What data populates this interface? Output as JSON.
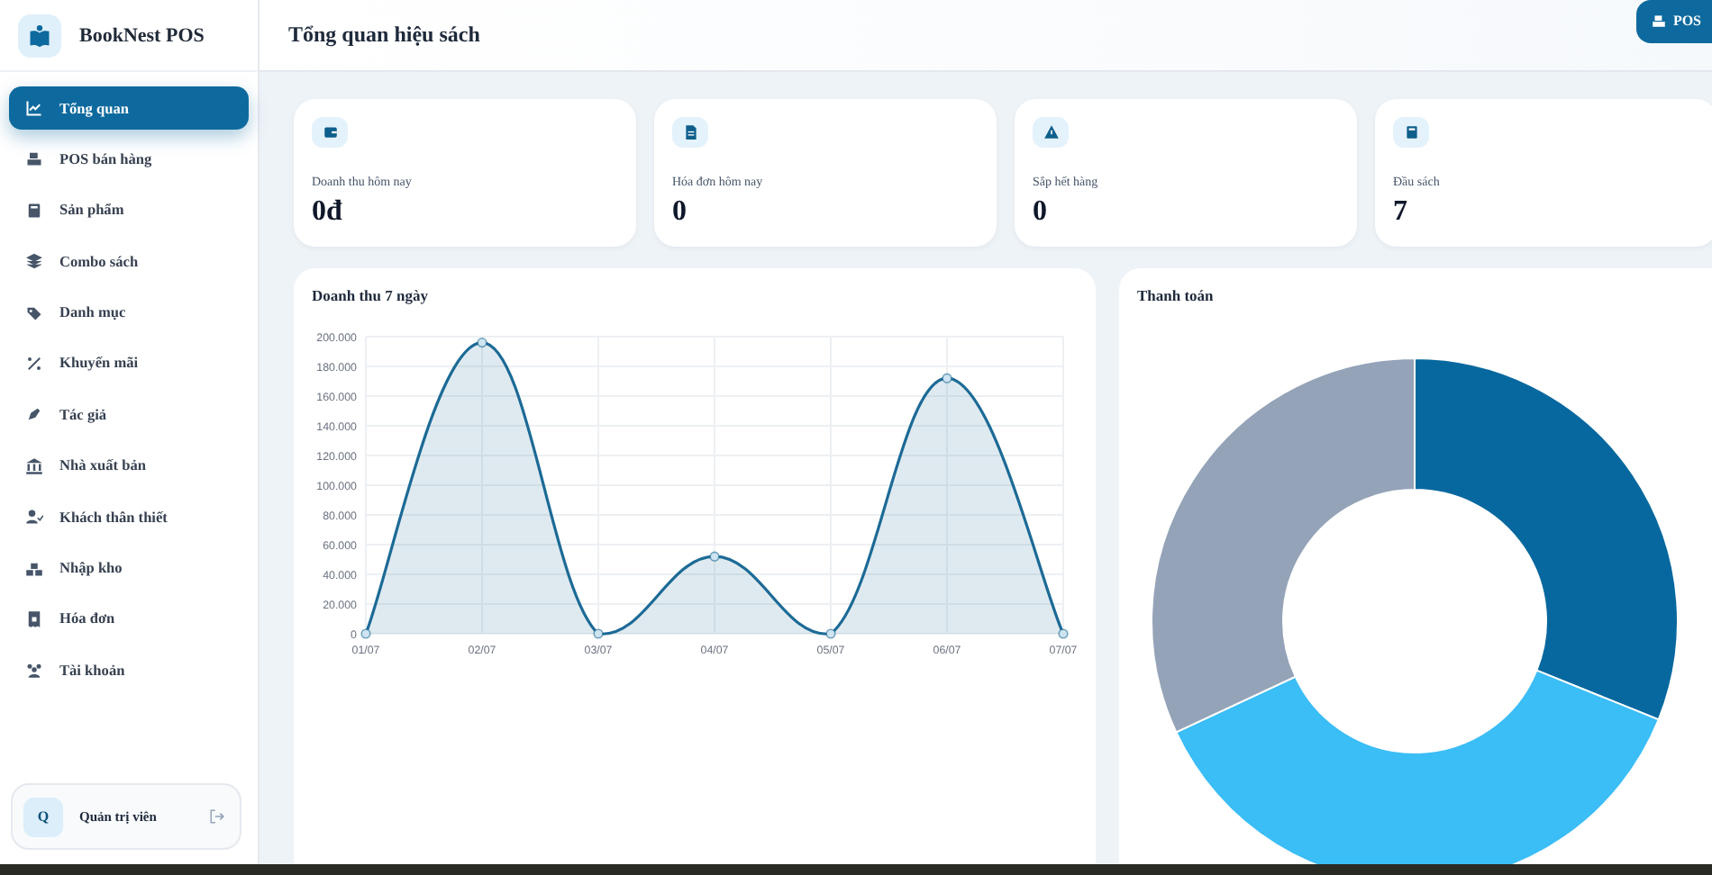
{
  "brand": {
    "name": "BookNest POS"
  },
  "sidebar": {
    "items": [
      {
        "label": "Tổng quan",
        "selected": true
      },
      {
        "label": "POS bán hàng",
        "selected": false
      },
      {
        "label": "Sản phẩm",
        "selected": false
      },
      {
        "label": "Combo sách",
        "selected": false
      },
      {
        "label": "Danh mục",
        "selected": false
      },
      {
        "label": "Khuyến mãi",
        "selected": false
      },
      {
        "label": "Tác giả",
        "selected": false
      },
      {
        "label": "Nhà xuất bản",
        "selected": false
      },
      {
        "label": "Khách thân thiết",
        "selected": false
      },
      {
        "label": "Nhập kho",
        "selected": false
      },
      {
        "label": "Hóa đơn",
        "selected": false
      },
      {
        "label": "Tài khoản",
        "selected": false
      }
    ],
    "user": {
      "avatar": "Q",
      "name": "Quản trị viên"
    }
  },
  "header": {
    "title": "Tổng quan hiệu sách",
    "button": "POS"
  },
  "stats": [
    {
      "label": "Doanh thu hôm nay",
      "value": "0đ"
    },
    {
      "label": "Hóa đơn hôm nay",
      "value": "0"
    },
    {
      "label": "Sắp hết hàng",
      "value": "0"
    },
    {
      "label": "Đầu sách",
      "value": "7"
    }
  ],
  "revenue": {
    "title": "Doanh thu 7 ngày",
    "chart_data": {
      "type": "area",
      "categories": [
        "01/07",
        "02/07",
        "03/07",
        "04/07",
        "05/07",
        "06/07",
        "07/07"
      ],
      "series": [
        {
          "color": "#1c6a96",
          "values": [
            0,
            196000,
            0,
            52000,
            0,
            172000,
            0
          ]
        }
      ],
      "grid": true,
      "ylim": [
        0,
        200000
      ],
      "yticks": [
        {
          "value": 0,
          "label": "0"
        },
        {
          "value": 20000,
          "label": "20.000"
        },
        {
          "value": 40000,
          "label": "40.000"
        },
        {
          "value": 60000,
          "label": "60.000"
        },
        {
          "value": 80000,
          "label": "80.000"
        },
        {
          "value": 100000,
          "label": "100.000"
        },
        {
          "value": 120000,
          "label": "120.000"
        },
        {
          "value": 140000,
          "label": "140.000"
        },
        {
          "value": 160000,
          "label": "160.000"
        },
        {
          "value": 180000,
          "label": "180.000"
        },
        {
          "value": 200000,
          "label": "200.000"
        }
      ]
    }
  },
  "payment": {
    "title": "Thanh toán",
    "slices": [
      {
        "color": "#07689f"
      },
      {
        "color": "#3bbdf5"
      },
      {
        "color": "#94a3b8"
      }
    ]
  }
}
